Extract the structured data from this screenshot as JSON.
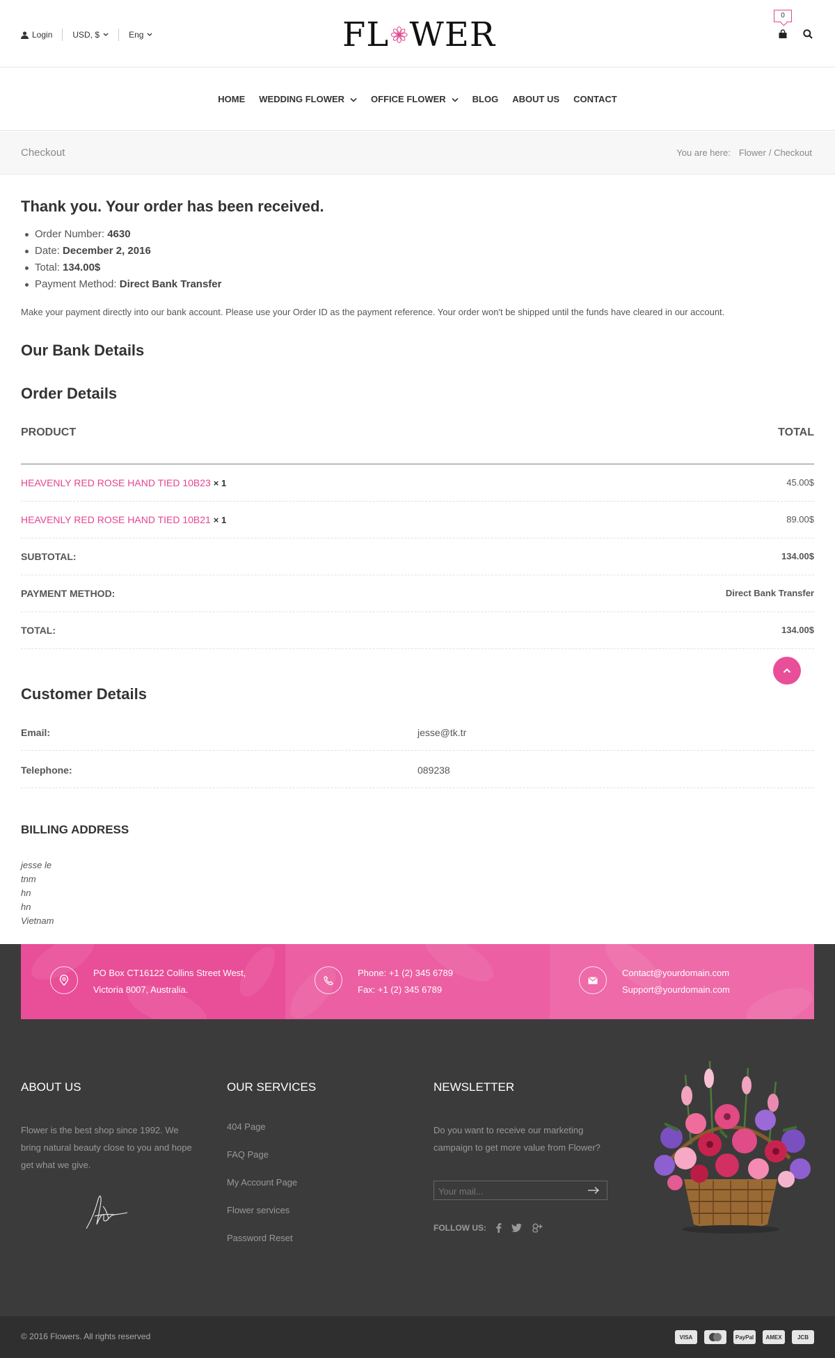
{
  "header": {
    "login": "Login",
    "currency": "USD, $",
    "language": "Eng",
    "logo_left": "FL",
    "logo_right": "WER",
    "cart_count": "0"
  },
  "nav": [
    {
      "label": "HOME"
    },
    {
      "label": "WEDDING FLOWER"
    },
    {
      "label": "OFFICE FLOWER"
    },
    {
      "label": "BLOG"
    },
    {
      "label": "ABOUT US"
    },
    {
      "label": "CONTACT"
    }
  ],
  "breadcrumb": {
    "title": "Checkout",
    "prefix": "You are here:",
    "home": "Flower",
    "current": "/ Checkout"
  },
  "order": {
    "heading": "Thank you. Your order has been received.",
    "number_label": "Order Number:",
    "number": "4630",
    "date_label": "Date:",
    "date": "December 2, 2016",
    "total_label": "Total:",
    "total": "134.00$",
    "method_label": "Payment Method:",
    "method": "Direct Bank Transfer",
    "note": "Make your payment directly into our bank account. Please use your Order ID as the payment reference. Your order won't be shipped until the funds have cleared in our account."
  },
  "bank_heading": "Our Bank Details",
  "details_heading": "Order Details",
  "table": {
    "product_col": "PRODUCT",
    "total_col": "TOTAL",
    "items": [
      {
        "name": "HEAVENLY RED ROSE HAND TIED 10B23",
        "qty": "× 1",
        "price": "45.00$"
      },
      {
        "name": "HEAVENLY RED ROSE HAND TIED 10B21",
        "qty": "× 1",
        "price": "89.00$"
      }
    ],
    "subtotal_label": "SUBTOTAL:",
    "subtotal": "134.00$",
    "payment_label": "PAYMENT METHOD:",
    "payment": "Direct Bank Transfer",
    "total_label": "TOTAL:",
    "total": "134.00$"
  },
  "customer": {
    "heading": "Customer Details",
    "email_label": "Email:",
    "email": "jesse@tk.tr",
    "phone_label": "Telephone:",
    "phone": "089238"
  },
  "billing": {
    "heading": "BILLING ADDRESS",
    "lines": [
      "jesse le",
      "tnm",
      "hn",
      "hn",
      "Vietnam"
    ]
  },
  "contact": {
    "address1": "PO Box CT16122 Collins Street West,",
    "address2": "Victoria 8007, Australia.",
    "phone": "Phone: +1 (2) 345 6789",
    "fax": "Fax: +1 (2) 345 6789",
    "email1": "Contact@yourdomain.com",
    "email2": "Support@yourdomain.com"
  },
  "footer": {
    "about_heading": "ABOUT US",
    "about_text": "Flower is the best shop since 1992. We bring natural beauty close to you and hope get what we give.",
    "services_heading": "OUR SERVICES",
    "services": [
      "404 Page",
      "FAQ Page",
      "My Account Page",
      "Flower services",
      "Password Reset"
    ],
    "newsletter_heading": "NEWSLETTER",
    "newsletter_text": "Do you want to receive our marketing campaign to get more value from Flower?",
    "mail_placeholder": "Your mail...",
    "follow_label": "FOLLOW US:",
    "copyright": "© 2016 Flowers. All rights reserved",
    "payments": [
      "VISA",
      "MC",
      "PayPal",
      "AMEX",
      "JCB"
    ]
  },
  "colors": {
    "accent": "#e3458f",
    "contact_bar": "#e94e98",
    "footer_bg": "#3b3b3b",
    "copy_bg": "#2f2f2f"
  }
}
